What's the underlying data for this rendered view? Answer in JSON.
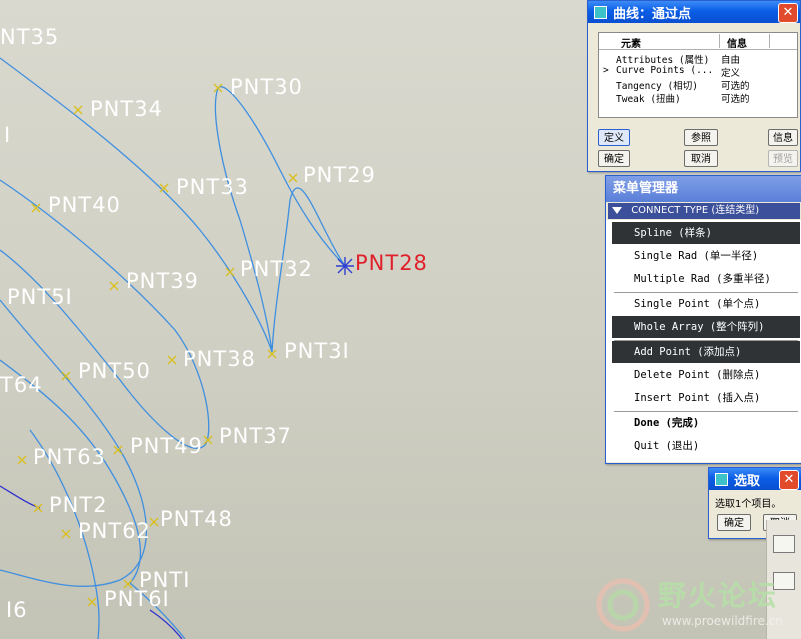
{
  "viewport": {
    "points": [
      {
        "label": "NT35"
      },
      {
        "label": "PNT34"
      },
      {
        "label": "PNT30"
      },
      {
        "label": "I"
      },
      {
        "label": "PNT33"
      },
      {
        "label": "PNT29"
      },
      {
        "label": "PNT40"
      },
      {
        "label": "PNT28"
      },
      {
        "label": "PNT32"
      },
      {
        "label": "PNT39"
      },
      {
        "label": "PNT5I"
      },
      {
        "label": "PNT3I"
      },
      {
        "label": "PNT38"
      },
      {
        "label": "PNT50"
      },
      {
        "label": "T64"
      },
      {
        "label": "PNT37"
      },
      {
        "label": "PNT49"
      },
      {
        "label": "PNT63"
      },
      {
        "label": "PNT2"
      },
      {
        "label": "PNT48"
      },
      {
        "label": "PNT62"
      },
      {
        "label": "PNTI"
      },
      {
        "label": "PNT6I"
      },
      {
        "label": "I6"
      }
    ],
    "selected_point": "PNT28"
  },
  "curve_dialog": {
    "title": "曲线：通过点",
    "col_element": "元素",
    "col_info": "信息",
    "rows": [
      {
        "marker": "",
        "element": "Attributes (属性)",
        "info": "自由"
      },
      {
        "marker": ">",
        "element": "Curve Points (...",
        "info": "定义"
      },
      {
        "marker": "",
        "element": "Tangency (相切)",
        "info": "可选的"
      },
      {
        "marker": "",
        "element": "Tweak (扭曲)",
        "info": "可选的"
      }
    ],
    "btn_define": "定义",
    "btn_refs": "参照",
    "btn_info": "信息",
    "btn_ok": "确定",
    "btn_cancel": "取消",
    "btn_preview": "预览"
  },
  "menu_manager": {
    "title": "菜单管理器",
    "section": "CONNECT TYPE (连结类型)",
    "items": [
      {
        "label": "Spline (样条)"
      },
      {
        "label": "Single Rad (单一半径)"
      },
      {
        "label": "Multiple Rad (多重半径)"
      },
      {
        "label": "Single Point (单个点)"
      },
      {
        "label": "Whole Array (整个阵列)"
      },
      {
        "label": "Add Point (添加点)"
      },
      {
        "label": "Delete Point (删除点)"
      },
      {
        "label": "Insert Point (插入点)"
      },
      {
        "label": "Done (完成)"
      },
      {
        "label": "Quit (退出)"
      }
    ]
  },
  "select_dialog": {
    "title": "选取",
    "message": "选取1个项目。",
    "btn_ok": "确定",
    "btn_cancel": "取消"
  },
  "watermark": {
    "text": "野火论坛",
    "url": "www.proewildfire.cn"
  },
  "colors": {
    "highlight": "#2f3336",
    "title_blue": "#0b5ee7",
    "selected_point": "#e0202a",
    "curve": "#3f8fe0"
  }
}
